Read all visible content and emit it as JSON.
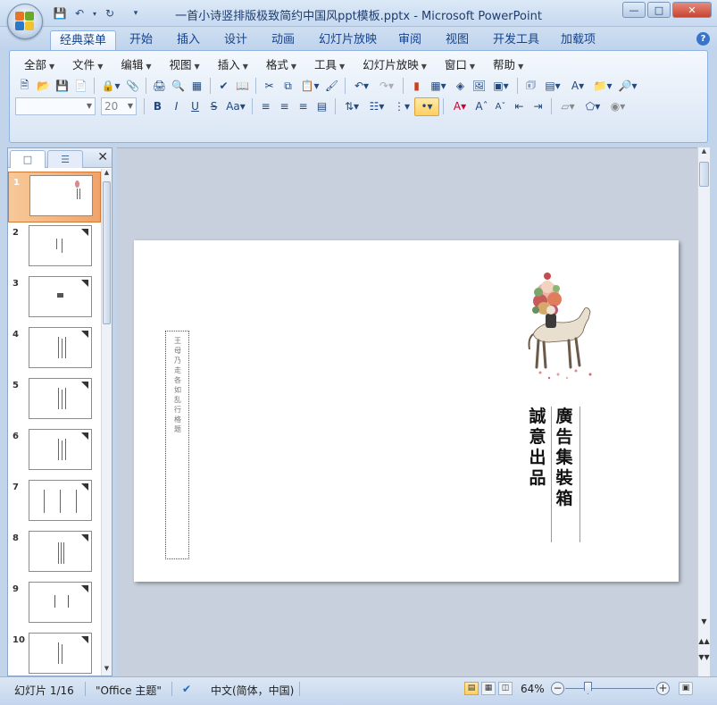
{
  "window": {
    "title": "一首小诗竖排版极致简约中国风ppt模板.pptx - Microsoft PowerPoint",
    "controls": {
      "minimize": "—",
      "maximize": "□",
      "close": "✕"
    }
  },
  "qat": [
    "save-icon",
    "undo-icon",
    "redo-icon",
    "customize-icon"
  ],
  "tabs": [
    {
      "label": "经典菜单",
      "active": true
    },
    {
      "label": "开始"
    },
    {
      "label": "插入"
    },
    {
      "label": "设计"
    },
    {
      "label": "动画"
    },
    {
      "label": "幻灯片放映"
    },
    {
      "label": "审阅"
    },
    {
      "label": "视图"
    },
    {
      "label": "开发工具"
    },
    {
      "label": "加载项"
    }
  ],
  "menubar": [
    "全部",
    "文件",
    "编辑",
    "视图",
    "插入",
    "格式",
    "工具",
    "幻灯片放映",
    "窗口",
    "帮助"
  ],
  "format": {
    "font_name": "",
    "font_size": "20"
  },
  "thumbnails": [
    {
      "num": "1"
    },
    {
      "num": "2"
    },
    {
      "num": "3"
    },
    {
      "num": "4"
    },
    {
      "num": "5"
    },
    {
      "num": "6"
    },
    {
      "num": "7"
    },
    {
      "num": "8"
    },
    {
      "num": "9"
    },
    {
      "num": "10"
    }
  ],
  "slide": {
    "small_vertical": "王母乃走各如乱行格题",
    "main_title": "廣告集裝箱",
    "subtitle": "誠意出品"
  },
  "status": {
    "slide_info": "幻灯片 1/16",
    "theme": "\"Office 主题\"",
    "language": "中文(简体，中国)",
    "zoom": "64%",
    "zoom_fraction": 0.25
  }
}
